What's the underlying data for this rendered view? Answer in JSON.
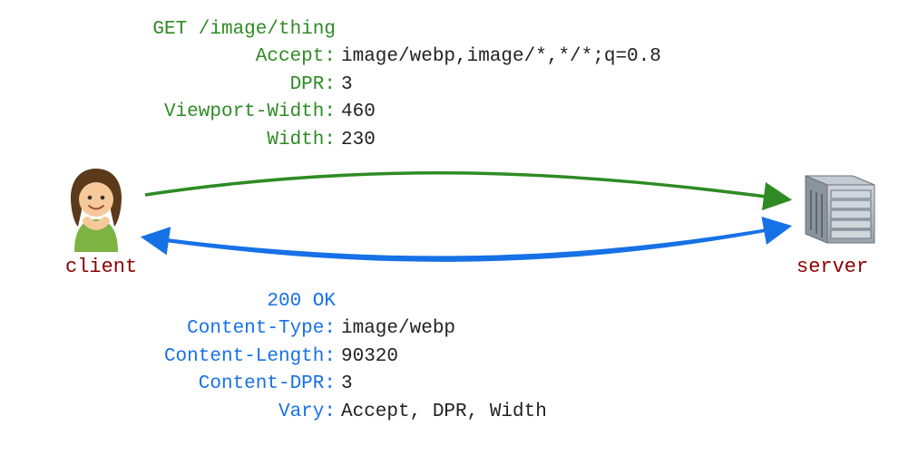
{
  "labels": {
    "client": "client",
    "server": "server"
  },
  "request": {
    "line": "GET /image/thing",
    "headers": [
      {
        "name": "Accept",
        "value": "image/webp,image/*,*/*;q=0.8"
      },
      {
        "name": "DPR",
        "value": "3"
      },
      {
        "name": "Viewport-Width",
        "value": "460"
      },
      {
        "name": "Width",
        "value": "230"
      }
    ]
  },
  "response": {
    "status": "200 OK",
    "headers": [
      {
        "name": "Content-Type",
        "value": "image/webp"
      },
      {
        "name": "Content-Length",
        "value": "90320"
      },
      {
        "name": "Content-DPR",
        "value": "3"
      },
      {
        "name": "Vary",
        "value": "Accept, DPR, Width"
      }
    ]
  },
  "colors": {
    "req": "#2e8b24",
    "res": "#1771e6",
    "accent": "#8b0000"
  }
}
